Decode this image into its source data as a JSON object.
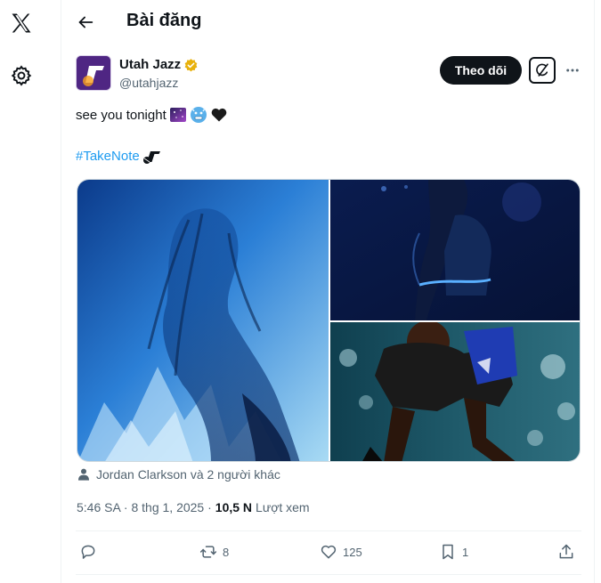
{
  "header": {
    "title": "Bài đăng"
  },
  "author": {
    "name": "Utah Jazz",
    "handle": "@utahjazz",
    "verified_color": "#e8b10c"
  },
  "follow": {
    "label": "Theo dõi"
  },
  "tweet": {
    "text": "see you tonight",
    "hashtag": "#TakeNote"
  },
  "tagged": {
    "text": "Jordan Clarkson và 2 người khác"
  },
  "meta": {
    "time_date": "5:46 SA · 8 thg 1, 2025 ·",
    "views": "10,5 N",
    "views_label": "Lượt xem"
  },
  "actions": {
    "replies": "",
    "reposts": "8",
    "likes": "125",
    "bookmarks": "1"
  },
  "colors": {
    "accent": "#1d9bf0",
    "text": "#0f1419",
    "muted": "#536471",
    "brand": "#4f2683"
  },
  "icons": [
    "x-logo-icon",
    "gear-icon",
    "back-arrow-icon",
    "verified-icon",
    "grok-icon",
    "more-icon",
    "person-icon",
    "reply-icon",
    "repost-icon",
    "like-icon",
    "bookmark-icon",
    "share-icon"
  ]
}
